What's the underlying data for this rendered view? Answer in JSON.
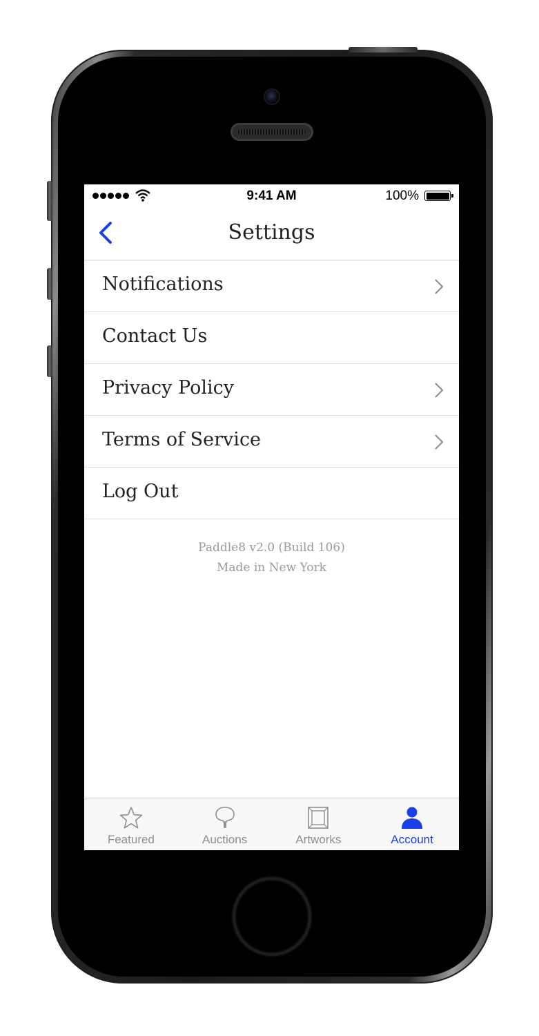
{
  "status_bar": {
    "time": "9:41 AM",
    "battery": "100%",
    "signal_icon": "cellular-signal-icon",
    "wifi_icon": "wifi-icon",
    "battery_icon": "battery-icon",
    "battery_level": 1.0
  },
  "nav": {
    "title": "Settings",
    "back_icon": "chevron-left-icon"
  },
  "menu": {
    "items": [
      {
        "label": "Notifications",
        "has_chevron": true
      },
      {
        "label": "Contact Us",
        "has_chevron": false
      },
      {
        "label": "Privacy Policy",
        "has_chevron": true
      },
      {
        "label": "Terms of Service",
        "has_chevron": true
      },
      {
        "label": "Log Out",
        "has_chevron": false
      }
    ]
  },
  "footer": {
    "version": "Paddle8 v2.0 (Build 106)",
    "made_in": "Made in New York"
  },
  "tabs": [
    {
      "label": "Featured",
      "icon": "star-icon",
      "active": false
    },
    {
      "label": "Auctions",
      "icon": "paddle-icon",
      "active": false
    },
    {
      "label": "Artworks",
      "icon": "frame-icon",
      "active": false
    },
    {
      "label": "Account",
      "icon": "person-icon",
      "active": true
    }
  ],
  "colors": {
    "accent": "#1a3fe6",
    "text": "#222222",
    "muted": "#9a9a9a",
    "tab_inactive": "#8e8e93"
  }
}
